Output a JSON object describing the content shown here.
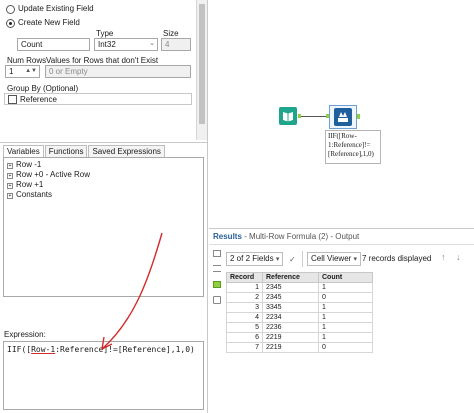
{
  "config": {
    "update_existing_label": "Update Existing Field",
    "create_new_label": "Create New  Field",
    "type_label": "Type",
    "size_label": "Size",
    "field_name_value": "Count",
    "type_value": "Int32",
    "size_value": "4",
    "num_rows_label": "Num Rows",
    "values_label": "Values for Rows that don't Exist",
    "num_rows_value": "1",
    "values_value": "0 or Empty",
    "group_by_label": "Group By (Optional)",
    "group_by_field": "Reference"
  },
  "tabs": [
    "Variables",
    "Functions",
    "Saved Expressions"
  ],
  "tree": [
    "Row -1",
    "Row +0 - Active Row",
    "Row +1",
    "Constants"
  ],
  "expression": {
    "label": "Expression:",
    "prefix": "IIF([",
    "underlined": "Row-1",
    "suffix": ":Reference]!=[Reference],1,0)"
  },
  "canvas": {
    "annotation_lines": [
      "IIF([Row-",
      "1:Reference]!=",
      "[Reference],1,0)"
    ]
  },
  "results": {
    "title": "Results",
    "subtitle": "- Multi-Row Formula (2) - Output",
    "fields_label": "2 of 2 Fields",
    "viewer_label": "Cell Viewer",
    "records_label": "7 records displayed",
    "columns": [
      "Record",
      "Reference",
      "Count"
    ],
    "rows": [
      [
        "1",
        "2345",
        "1"
      ],
      [
        "2",
        "2345",
        "0"
      ],
      [
        "3",
        "3345",
        "1"
      ],
      [
        "4",
        "2234",
        "1"
      ],
      [
        "5",
        "2236",
        "1"
      ],
      [
        "6",
        "2219",
        "1"
      ],
      [
        "7",
        "2219",
        "0"
      ]
    ]
  },
  "colors": {
    "arrow": "#d42a2a",
    "input_tool": "#1fa58c",
    "formula_tool": "#1f5f9c",
    "connector": "#8fcf3f"
  }
}
